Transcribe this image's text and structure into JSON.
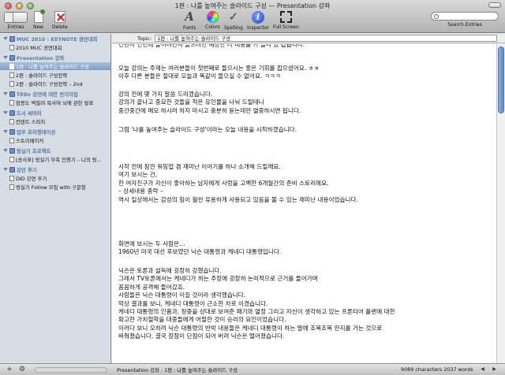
{
  "window": {
    "title": "1편 : 나를 높여주는 슬라이드 구성 — Presentation 강좌"
  },
  "toolbar": {
    "entries_label": "Entries",
    "new_label": "New",
    "delete_label": "Delete",
    "fonts_label": "Fonts",
    "colors_label": "Colors",
    "spelling_label": "Spelling",
    "inspector_label": "Inspector",
    "fullscreen_label": "Full Screen",
    "search_label": "Search Entries"
  },
  "sidebar": {
    "rows": [
      {
        "kind": "group",
        "label": "MUC 2010 : KEYNOTE 경연대회"
      },
      {
        "kind": "entry",
        "label": "2010 MUC 경연대회"
      },
      {
        "kind": "group",
        "label": "Presentation 강좌"
      },
      {
        "kind": "entry",
        "label": "1편 : 나를 높여주는 슬라이드 구성",
        "selected": true
      },
      {
        "kind": "entry",
        "label": "2편 : 슬라이드 구성전략"
      },
      {
        "kind": "entry",
        "label": "2편 : 슬라이드 구성전략 – 2nd"
      },
      {
        "kind": "group",
        "label": "TEDx 강연에 대한 변지아업"
      },
      {
        "kind": "entry",
        "label": "잠봉도 떡필려 복사여 뇌에 관한 발표"
      },
      {
        "kind": "group",
        "label": "도서 써머리"
      },
      {
        "kind": "entry",
        "label": "컨텐트 스피치"
      },
      {
        "kind": "group",
        "label": "업무 프리젠테이션"
      },
      {
        "kind": "entry",
        "label": "스토리메이커"
      },
      {
        "kind": "group",
        "label": "링실기 프로젝트"
      },
      {
        "kind": "entry",
        "label": "[송사표] 링실기 부축 인령기 – 나의 링..."
      },
      {
        "kind": "group",
        "label": "강연 후기"
      },
      {
        "kind": "entry",
        "label": "DID 강연 후기"
      },
      {
        "kind": "entry",
        "label": "링실기 Follow 모임 with 구문형"
      }
    ]
  },
  "topic": {
    "label": "Topic:",
    "value": "1편 : 나를 높여주는 슬라이드 구성"
  },
  "editor": {
    "paragraphs": [
      [
        "건년이 인연에 들이려면서 놀으려면 예상한 다 대중을 가 들다 있 갑습니다."
      ],
      [
        "오늘 강의는 주제는 여러분들이 첫번째로 들으시는 좋은 기회를 잡으셨어요. ㅎㅎ",
        "이후 다른 분들은 절대로 오늘과 똑같이 들으실 수 없어요. ㅋㅋㅋ"
      ],
      [
        "강의 전에 몇 가지 말씀 드리겠습니다.",
        "강의가 끝나고 중요한 것들을 적은 유인물을 나눠 드릴테니",
        "중간중간에 메모 하시려 하지 마시고 충분히 듣는데만 열중하시면 됩니다."
      ],
      [
        "그럼 '나를 높여주는 슬라이드 구성'이라는 오늘 내용을 시작하겠습니다."
      ],
      [
        "시작 전에 잠깐 워밍업 겸 재미난 이야기를 하나 소개해 드릴께요.",
        "여기 보시는 건,",
        "한 여자친구가 자신이 좋아하는 남자에게 사랑을 고백한 6개월간의 준비 스토리에요.",
        "– 상세내용 중략 –",
        "역시 일상에서는 감성의 힘이 훨씬 유용하게 사용되고 있음을 볼 수 있는 재미난 내용이었습니다."
      ],
      [
        "화면에 보시는 두 사람은…",
        "1960년 미국 대선 후보였던 닉슨 대통령과 케네디 대통령입니다."
      ],
      [
        "닉슨은 토론과 설득에 굉장히 강했습니다.",
        "그래서 TV토론에서는 케네디가 하는 주장에 굉장히 논리적으로 근거를 들어가며",
        "꼼꼼하게 공격해 들어갔죠.",
        "사람들은 닉슨 대통령이 이길 것이라 생각했습니다.",
        "막상 결과를 보니, 케네디 대통령이 근소한 차로 이겼습니다.",
        "케네디 대통령의 인품과, 청중을 상대로 보여준 패기와 열정 그리고 자신이 생각하고 있는 프론티어 플랜에 대한",
        "확고한 가치철학을 대중들에게 어필한 것이 승리의 요인이었습니다.",
        "이러다 보니 오히려 닉슨 대통령의 반박 내용들은 케네디 대통령이 하는 말에 조목조목 딴지를 거는 것으로",
        "비춰졌습니다. 결국 장점이 단점이 되어 버려 닉슨은 떨어졌습니다."
      ]
    ]
  },
  "status": {
    "path": "Presentation 강좌 : 1편 : 나를 높여주는 슬라이드 구성",
    "count": "9089 characters 2037 words",
    "pct": "15%"
  }
}
